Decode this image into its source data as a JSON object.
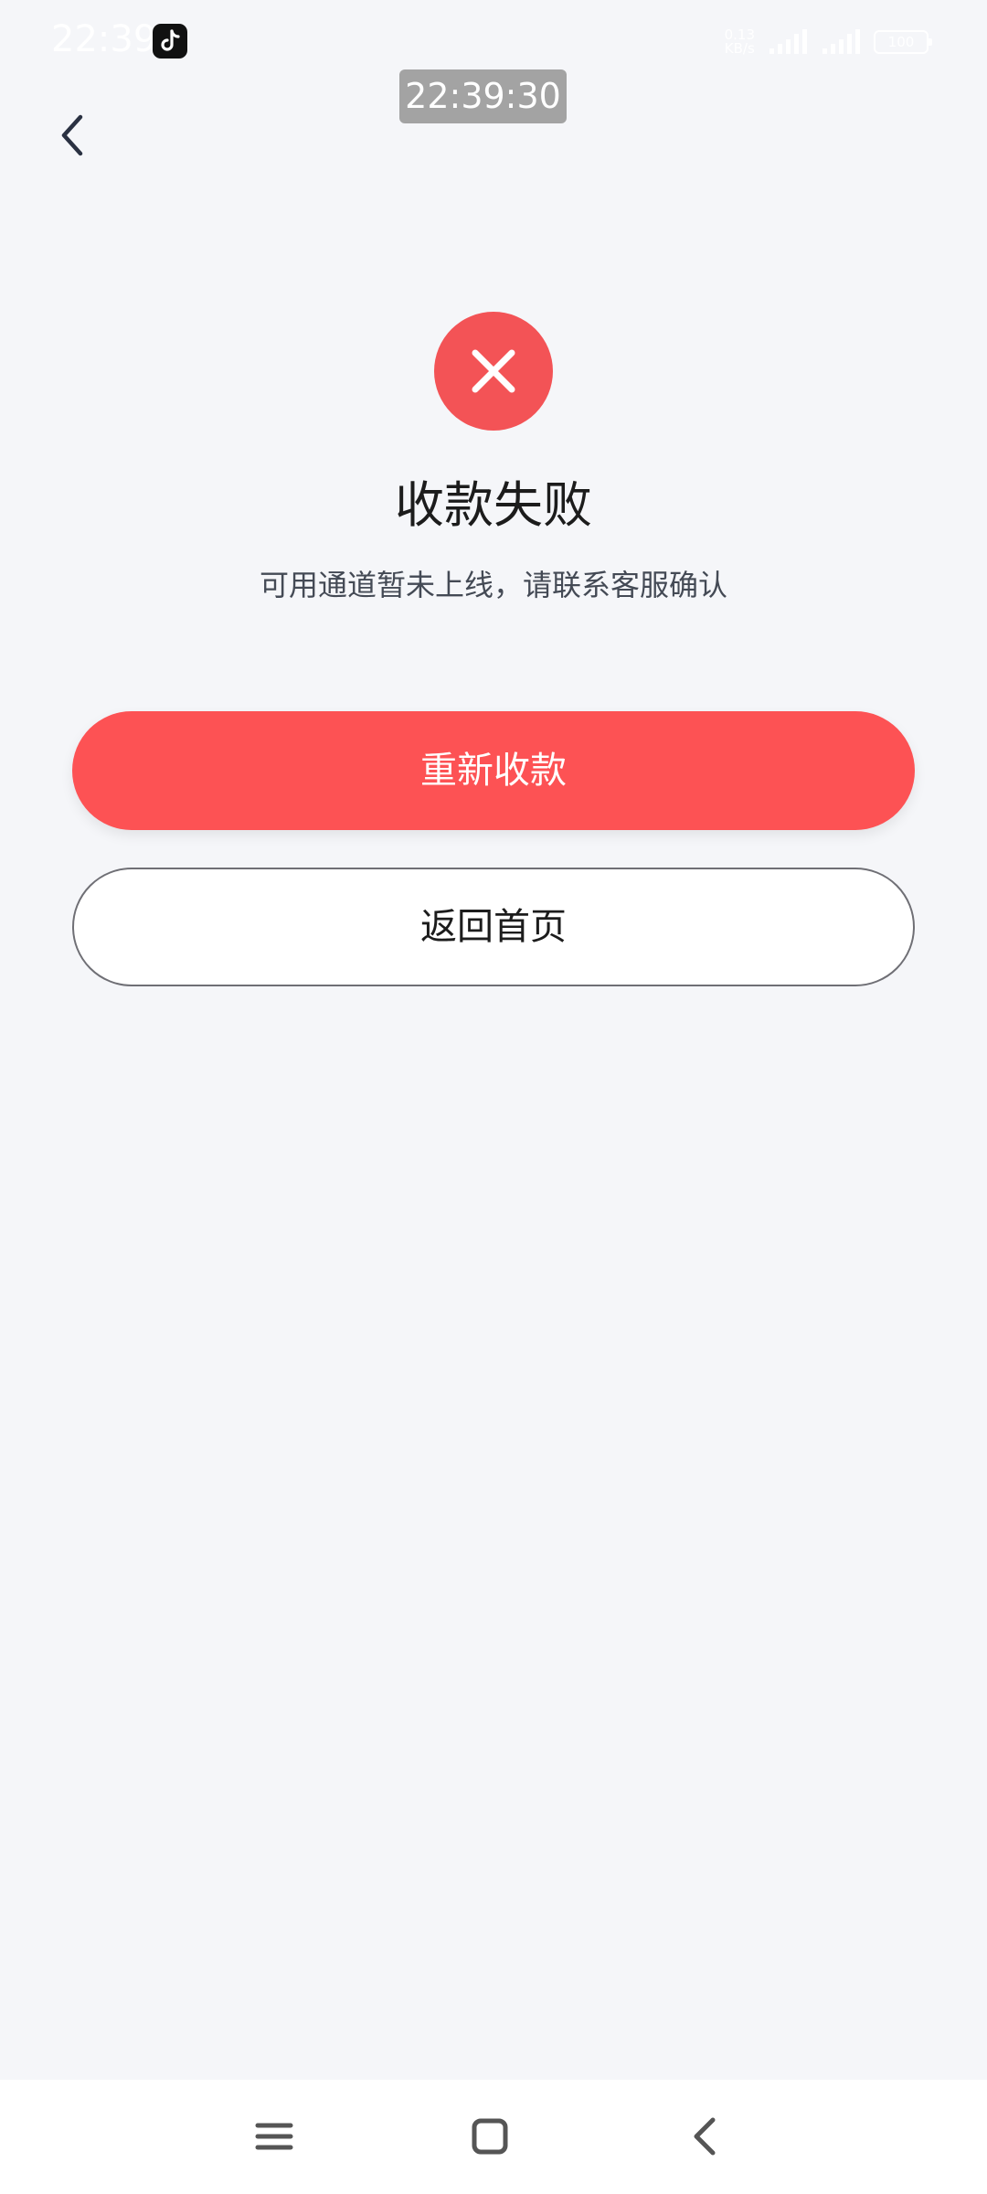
{
  "status_bar": {
    "time": "22:39",
    "net_speed_value": "0.13",
    "net_speed_unit": "KB/s",
    "battery": "100"
  },
  "timestamp_overlay": "22:39:30",
  "result": {
    "title": "收款失败",
    "description": "可用通道暂未上线，请联系客服确认"
  },
  "buttons": {
    "retry_label": "重新收款",
    "home_label": "返回首页"
  },
  "icons": {
    "back": "chevron-left-icon",
    "fail": "close-icon",
    "nav_menu": "menu-icon",
    "nav_home": "square-icon",
    "nav_back": "chevron-left-icon"
  },
  "colors": {
    "background": "#f5f6f9",
    "fail_red": "#f35356",
    "primary_button": "#fd5254",
    "title_text": "#1c1c1c"
  }
}
